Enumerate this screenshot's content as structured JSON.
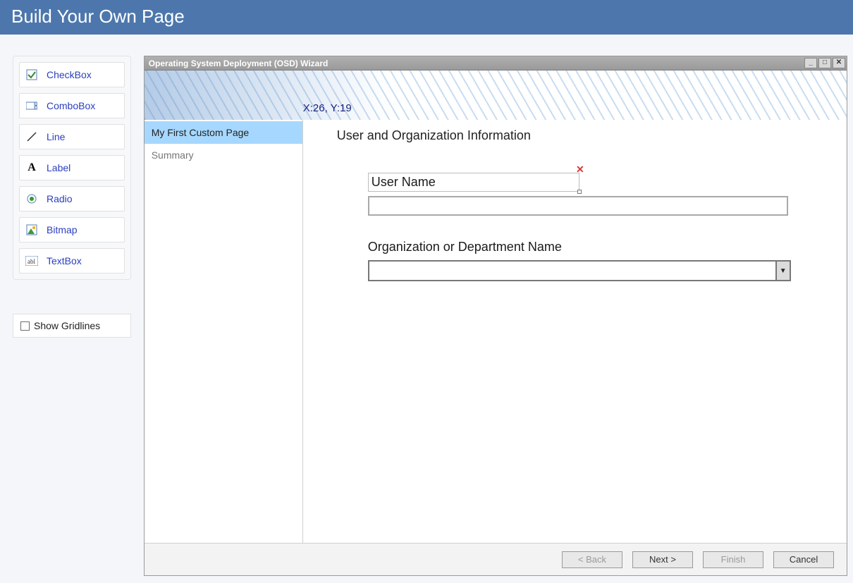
{
  "header": {
    "title": "Build Your Own Page"
  },
  "palette": {
    "items": [
      {
        "label": "CheckBox"
      },
      {
        "label": "ComboBox"
      },
      {
        "label": "Line"
      },
      {
        "label": "Label"
      },
      {
        "label": "Radio"
      },
      {
        "label": "Bitmap"
      },
      {
        "label": "TextBox"
      }
    ]
  },
  "options": {
    "show_gridlines_label": "Show Gridlines",
    "show_gridlines_checked": false
  },
  "wizard": {
    "title": "Operating System Deployment (OSD) Wizard",
    "coords": "X:26, Y:19",
    "nav": [
      {
        "label": "My First Custom Page",
        "active": true
      },
      {
        "label": "Summary",
        "active": false
      }
    ],
    "section_title": "User and Organization Information",
    "field_username_label": "User Name",
    "field_username_value": "",
    "field_org_label": "Organization or Department Name",
    "field_org_value": "",
    "buttons": {
      "back": "< Back",
      "next": "Next >",
      "finish": "Finish",
      "cancel": "Cancel"
    }
  }
}
